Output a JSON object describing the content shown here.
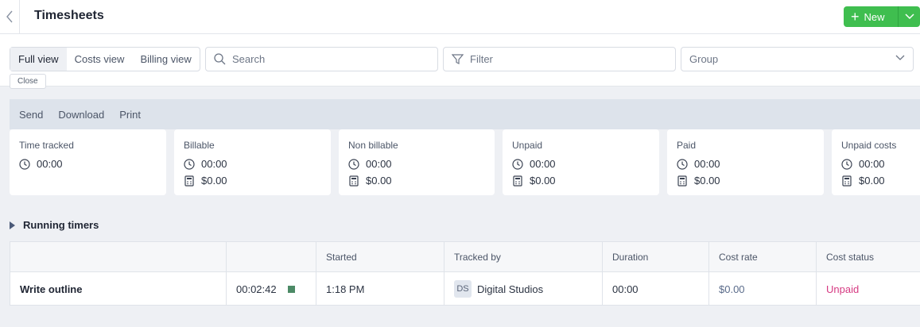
{
  "header": {
    "title": "Timesheets",
    "new_label": "New"
  },
  "views": {
    "tabs": [
      "Full view",
      "Costs view",
      "Billing view"
    ],
    "active": "Full view",
    "close_label": "Close"
  },
  "search": {
    "placeholder": "Search"
  },
  "filter": {
    "label": "Filter"
  },
  "group": {
    "label": "Group"
  },
  "actions": [
    "Send",
    "Download",
    "Print"
  ],
  "summary": [
    {
      "title": "Time tracked",
      "time": "00:00"
    },
    {
      "title": "Billable",
      "time": "00:00",
      "amount": "$0.00"
    },
    {
      "title": "Non billable",
      "time": "00:00",
      "amount": "$0.00"
    },
    {
      "title": "Unpaid",
      "time": "00:00",
      "amount": "$0.00"
    },
    {
      "title": "Paid",
      "time": "00:00",
      "amount": "$0.00"
    },
    {
      "title": "Unpaid costs",
      "time": "00:00",
      "amount": "$0.00"
    }
  ],
  "running": {
    "section_label": "Running timers",
    "columns": [
      "",
      "",
      "Started",
      "Tracked by",
      "Duration",
      "Cost rate",
      "Cost status"
    ],
    "rows": [
      {
        "name": "Write outline",
        "timer": "00:02:42",
        "started": "1:18 PM",
        "tracker_initials": "DS",
        "tracker": "Digital Studios",
        "duration": "00:00",
        "cost_rate": "$0.00",
        "cost_status": "Unpaid"
      }
    ]
  },
  "colors": {
    "accent_green": "#3fbe4f",
    "unpaid_pink": "#d63a82",
    "timer_square": "#4c8a66"
  },
  "icons": [
    "chevron-left-icon",
    "plus-icon",
    "chevron-down-icon",
    "search-icon",
    "filter-icon",
    "clock-icon",
    "calculator-icon",
    "caret-right-icon"
  ]
}
